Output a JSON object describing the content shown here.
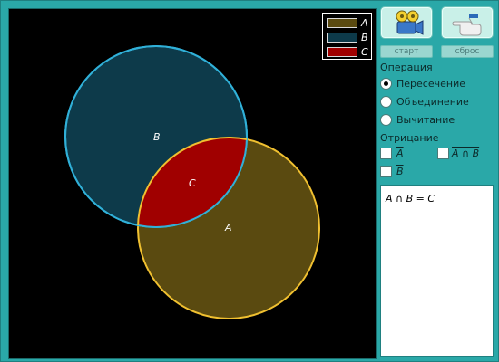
{
  "legend": [
    {
      "label": "A",
      "color": "#5a4a10"
    },
    {
      "label": "B",
      "color": "#0d3a4a"
    },
    {
      "label": "C",
      "color": "#a00000"
    }
  ],
  "diagram": {
    "set_a_label": "A",
    "set_b_label": "B",
    "intersection_label": "C",
    "colors": {
      "set_a_fill": "#5a4a10",
      "set_a_stroke": "#f0c030",
      "set_b_fill": "#0d3a4a",
      "set_b_stroke": "#30b0d8",
      "intersection_fill": "#a00000"
    }
  },
  "buttons": {
    "start_label": "старт",
    "reset_label": "сброс",
    "start_icon": "film-camera-icon",
    "reset_icon": "pointing-hand-icon"
  },
  "operation": {
    "title": "Операция",
    "options": [
      {
        "label": "Пересечение",
        "selected": true
      },
      {
        "label": "Объединение",
        "selected": false
      },
      {
        "label": "Вычитание",
        "selected": false
      }
    ]
  },
  "negation": {
    "title": "Отрицание",
    "not_a": "A",
    "not_a_and_b": "A ∩ B",
    "not_b": "B"
  },
  "result": {
    "formula": "A ∩ B = C"
  }
}
